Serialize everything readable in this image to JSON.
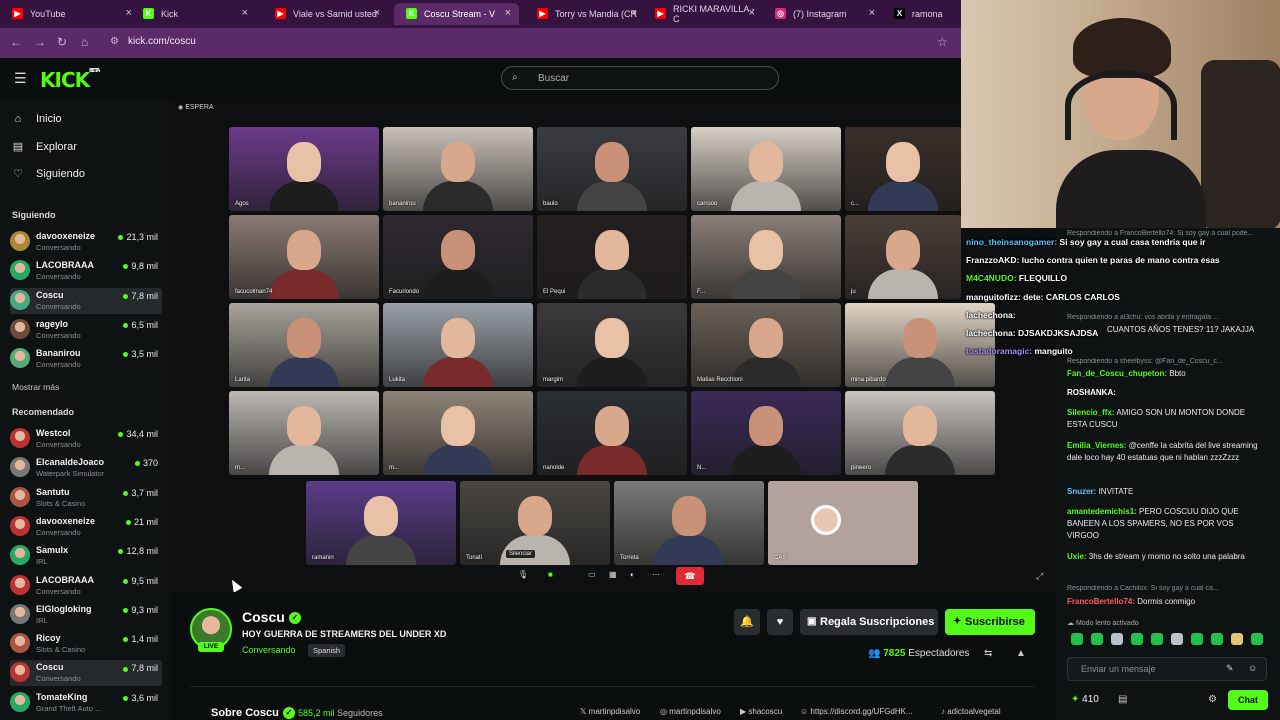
{
  "browser": {
    "tabs": [
      {
        "label": "YouTube",
        "color": "#ff0000",
        "glyph": "▶"
      },
      {
        "label": "Kick",
        "color": "#53fc18",
        "glyph": "K"
      },
      {
        "label": "Viale vs Samid usted",
        "color": "#ff0000",
        "glyph": "▶"
      },
      {
        "label": "Coscu Stream - V",
        "color": "#53fc18",
        "glyph": "K"
      },
      {
        "label": "Torry vs Mandia (CR",
        "color": "#ff0000",
        "glyph": "▶"
      },
      {
        "label": "RICKI MARAVILLA - C",
        "color": "#ff0000",
        "glyph": "▶"
      },
      {
        "label": "(7) Instagram",
        "color": "#d62976",
        "glyph": "◎"
      },
      {
        "label": "ramona",
        "color": "#000000",
        "glyph": "X"
      }
    ],
    "url": "kick.com/coscu"
  },
  "header": {
    "logo": "KICK",
    "logo_badge": "BETA",
    "search_placeholder": "Buscar"
  },
  "sidebar": {
    "nav": [
      {
        "label": "Inicio",
        "icon": "home-icon"
      },
      {
        "label": "Explorar",
        "icon": "compass-icon"
      },
      {
        "label": "Siguiendo",
        "icon": "heart-icon"
      }
    ],
    "following_title": "Siguiendo",
    "following": [
      {
        "name": "davooxeneize",
        "category": "Conversando",
        "viewers": "21,3 mil"
      },
      {
        "name": "LACOBRAAA",
        "category": "Conversando",
        "viewers": "9,8 mil"
      },
      {
        "name": "Coscu",
        "category": "Conversando",
        "viewers": "7,8 mil"
      },
      {
        "name": "rageylo",
        "category": "Conversando",
        "viewers": "6,5 mil"
      },
      {
        "name": "Bananirou",
        "category": "Conversando",
        "viewers": "3,5 mil"
      }
    ],
    "show_more": "Mostrar más",
    "recommended_title": "Recomendado",
    "recommended": [
      {
        "name": "Westcol",
        "category": "Conversando",
        "viewers": "34,4 mil"
      },
      {
        "name": "ElcanaldeJoaco",
        "category": "Waterpark Simulator",
        "viewers": "370"
      },
      {
        "name": "Santutu",
        "category": "Slots & Casino",
        "viewers": "3,7 mil"
      },
      {
        "name": "davooxeneize",
        "category": "Conversando",
        "viewers": "21 mil"
      },
      {
        "name": "Samulx",
        "category": "IRL",
        "viewers": "12,8 mil"
      },
      {
        "name": "LACOBRAAA",
        "category": "Conversando",
        "viewers": "9,5 mil"
      },
      {
        "name": "ElGlogloking",
        "category": "IRL",
        "viewers": "9,3 mil"
      },
      {
        "name": "Ricoy",
        "category": "Slots & Casino",
        "viewers": "1,4 mil"
      },
      {
        "name": "Coscu",
        "category": "Conversando",
        "viewers": "7,8 mil"
      },
      {
        "name": "TomateKing",
        "category": "Grand Theft Auto ...",
        "viewers": "3,6 mil"
      }
    ]
  },
  "video": {
    "status": "ESPERA",
    "participants": [
      "Agos",
      "bananirou",
      "baulo",
      "carrooo",
      "c...",
      "facucolman74",
      "Facuriondo",
      "El Pequi",
      "F...",
      "ju",
      "Larita",
      "Lukita",
      "margim",
      "Matias Recchioni",
      "mina pibardo",
      "m...",
      "m...",
      "nanoide",
      "N...",
      "pineero",
      "ramanin",
      "Tonati",
      "Torreta",
      "CAS"
    ],
    "tooltip": "Silenciar"
  },
  "stream": {
    "streamer": "Coscu",
    "live": "LIVE",
    "title": "HOY GUERRA DE STREAMERS DEL UNDER XD",
    "category": "Conversando",
    "language": "Spanish",
    "gift_label": "Regala Suscripciones",
    "subscribe_label": "Suscribirse",
    "viewers_count": "7825",
    "viewers_label": "Espectadores",
    "about_title": "Sobre Coscu",
    "followers_count": "585,2 mil",
    "followers_label": "Seguidores",
    "socials": [
      "martinpdisalvo",
      "martinpdisalvo",
      "shacoscu",
      "https://discord.gg/UFGdHK...",
      "adictoalvegetal"
    ]
  },
  "chat": {
    "overlay": [
      {
        "user": "nino_theinsanogamer:",
        "text": "Si soy gay a cual casa tendria que ir",
        "color": "#5ac8fa"
      },
      {
        "user": "FranzzoAKD:",
        "text": "lucho contra quien te paras de mano contra esas",
        "color": "#ffffff"
      },
      {
        "user": "M4C4NUDO:",
        "text": "FLEQUILLO",
        "color": "#53fc18"
      },
      {
        "user": "manguitofizz:",
        "text": "dete: CARLOS CARLOS",
        "color": "#ffffff"
      },
      {
        "user": "lachechona:",
        "text": "",
        "color": "#ffffff"
      },
      {
        "user": "lachechona:",
        "text": "DJSAKDJKSAJDSA",
        "color": "#ffffff"
      },
      {
        "user": "tostadoramagic:",
        "text": "manguito",
        "color": "#a78bfa"
      }
    ],
    "replies": [
      "Respondiendo a FrancoBertello74: Si soy gay a cual pode...",
      "Respondiendo a al3chu: vos abrila y entragala ...",
      "Respondiendo a sheelbyss: @Fan_de_Coscu_c...",
      "Respondiendo a Cachilox: Si soy gay a cual ca..."
    ],
    "messages": [
      {
        "user": "",
        "text": "CUANTOS AÑOS TENES? 11? JAKAJJA",
        "color": "#ff5c5c"
      },
      {
        "user": "Fan_de_Coscu_chupeton:",
        "text": "Bbto",
        "color": "#53fc18"
      },
      {
        "user": "ROSHANKA:",
        "text": "",
        "color": "#ffffff"
      },
      {
        "user": "Silencio_ffx:",
        "text": "AMIGO SON UN MONTON DONDE ESTA CUSCU",
        "color": "#53fc18"
      },
      {
        "user": "Emilia_Viernes:",
        "text": "@cenffe la cabrita del live streaming dale loco hay 40 estatuas que ni hablan zzzZzzz",
        "color": "#53fc18"
      },
      {
        "user": "Snuzer:",
        "text": "INVITATE",
        "color": "#5ac8fa"
      },
      {
        "user": "amantedemichis1:",
        "text": "PERO COSCUU DIJO QUE BANEEN A LOS SPAMERS, NO ES POR VOS VIRGOO",
        "color": "#53fc18"
      },
      {
        "user": "Uxie:",
        "text": "3hs de stream y momo no solto una palabra",
        "color": "#53fc18"
      },
      {
        "user": "FrancoBertello74:",
        "text": "Dormis conmigo",
        "color": "#ff5c5c"
      }
    ],
    "slow_mode": "Modo lento activado",
    "input_placeholder": "Enviar un mensaje",
    "points": "410",
    "chat_button": "Chat"
  }
}
